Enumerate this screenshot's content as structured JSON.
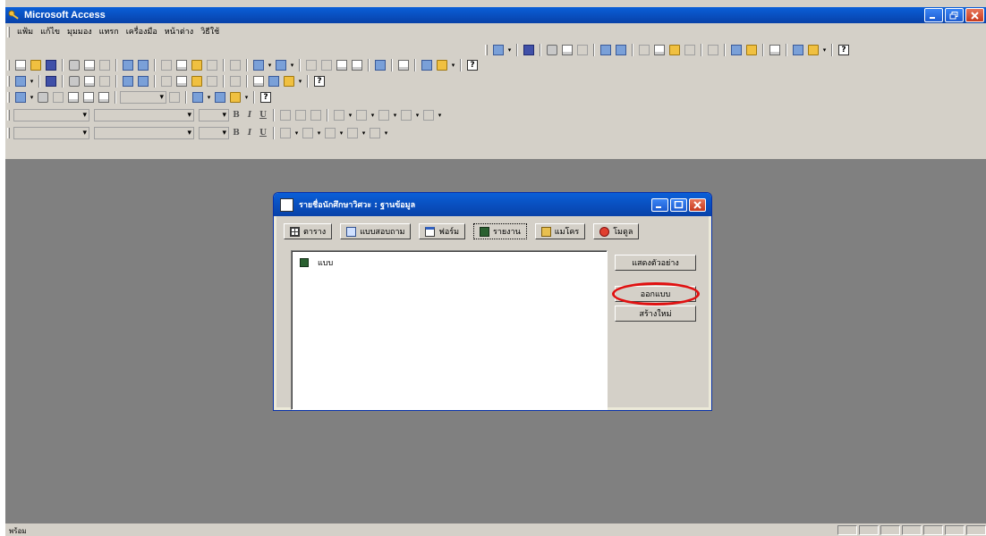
{
  "app": {
    "title": "Microsoft Access"
  },
  "menu": [
    "แฟ้ม",
    "แก้ไข",
    "มุมมอง",
    "แทรก",
    "เครื่องมือ",
    "หน้าต่าง",
    "วิธีใช้"
  ],
  "toolbar": {
    "help_glyph": "?",
    "bold": "B",
    "italic": "I",
    "underline": "U"
  },
  "db_window": {
    "title": "รายชื่อนักศึกษาวิศวะ : ฐานข้อมูล",
    "tabs": [
      {
        "label": "ตาราง",
        "icon": "table-icon"
      },
      {
        "label": "แบบสอบถาม",
        "icon": "query-icon"
      },
      {
        "label": "ฟอร์ม",
        "icon": "form-icon"
      },
      {
        "label": "รายงาน",
        "icon": "report-icon",
        "active": true
      },
      {
        "label": "แมโคร",
        "icon": "macro-icon"
      },
      {
        "label": "โมดูล",
        "icon": "module-icon"
      }
    ],
    "items": [
      {
        "label": "แบบ",
        "icon": "report-icon"
      }
    ],
    "buttons": {
      "preview": "แสดงตัวอย่าง",
      "design": "ออกแบบ",
      "new": "สร้างใหม่"
    }
  },
  "status": {
    "text": "พร้อม"
  },
  "colors": {
    "titlebar": "#0a5fd8",
    "workspace": "#808080",
    "highlight": "#e01010"
  }
}
